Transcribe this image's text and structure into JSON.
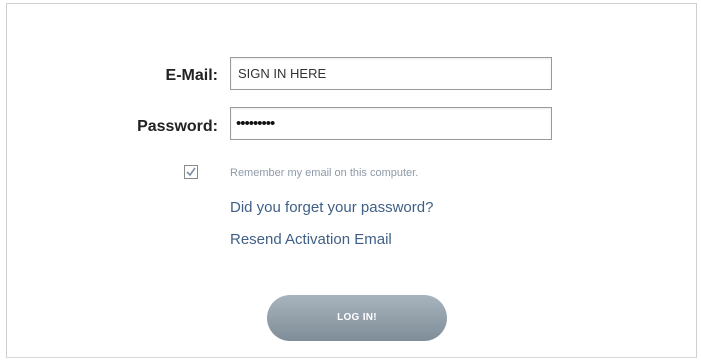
{
  "form": {
    "email_label": "E-Mail:",
    "email_value": "SIGN IN HERE",
    "password_label": "Password:",
    "password_mask": "•••••••••",
    "remember_checked": true,
    "remember_label": "Remember my email on this computer.",
    "forgot_link": "Did you forget your password?",
    "resend_link": "Resend Activation Email",
    "login_button": "LOG IN!"
  },
  "colors": {
    "link": "#3f5f86",
    "remember_text": "#8d9aa7",
    "button_top": "#a8b4bd",
    "button_bottom": "#7f8d98"
  },
  "icons": {
    "checkbox": "checkmark-icon"
  }
}
